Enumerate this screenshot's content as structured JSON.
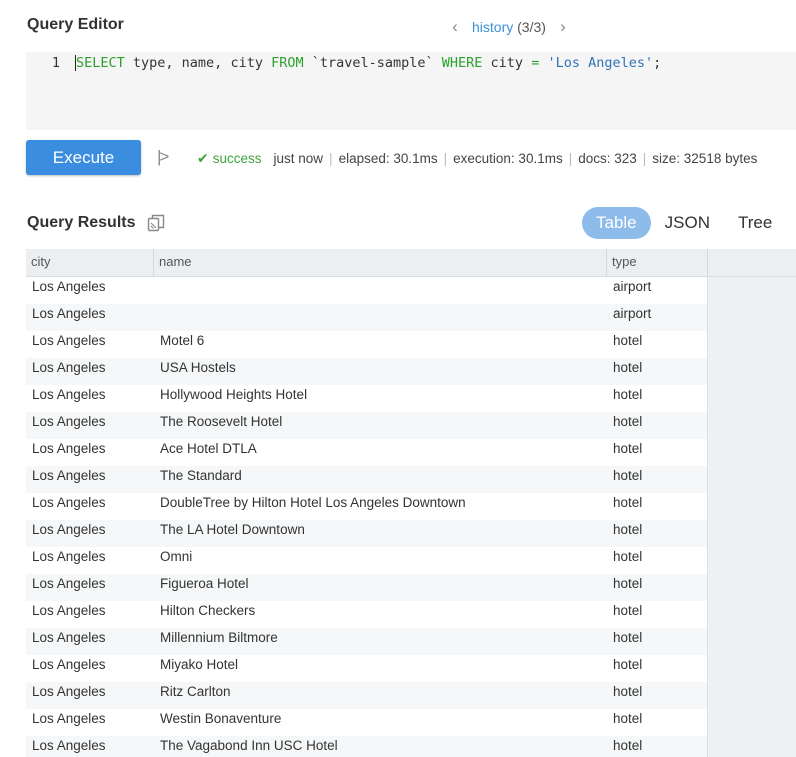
{
  "editor": {
    "title": "Query Editor",
    "history_link": "history",
    "history_count": "(3/3)",
    "line_number": "1",
    "query_tokens": [
      {
        "t": "SELECT",
        "k": "kw"
      },
      {
        "t": " type, name, city ",
        "k": "id"
      },
      {
        "t": "FROM",
        "k": "kw"
      },
      {
        "t": " `travel-sample` ",
        "k": "id"
      },
      {
        "t": "WHERE",
        "k": "kw"
      },
      {
        "t": " city ",
        "k": "id"
      },
      {
        "t": "=",
        "k": "kw"
      },
      {
        "t": " ",
        "k": "id"
      },
      {
        "t": "'Los Angeles'",
        "k": "str"
      },
      {
        "t": ";",
        "k": "id"
      }
    ]
  },
  "toolbar": {
    "execute_label": "Execute",
    "explain_label": "|>"
  },
  "status": {
    "result": "success",
    "when": "just now",
    "elapsed": "elapsed: 30.1ms",
    "execution": "execution: 30.1ms",
    "docs": "docs: 323",
    "size": "size: 32518 bytes"
  },
  "results": {
    "title": "Query Results",
    "tabs": [
      {
        "label": "Table",
        "active": true
      },
      {
        "label": "JSON",
        "active": false
      },
      {
        "label": "Tree",
        "active": false
      }
    ],
    "columns": [
      "city",
      "name",
      "type"
    ],
    "rows": [
      {
        "city": "Los Angeles",
        "name": "",
        "type": "airport"
      },
      {
        "city": "Los Angeles",
        "name": "",
        "type": "airport"
      },
      {
        "city": "Los Angeles",
        "name": "Motel 6",
        "type": "hotel"
      },
      {
        "city": "Los Angeles",
        "name": "USA Hostels",
        "type": "hotel"
      },
      {
        "city": "Los Angeles",
        "name": "Hollywood Heights Hotel",
        "type": "hotel"
      },
      {
        "city": "Los Angeles",
        "name": "The Roosevelt Hotel",
        "type": "hotel"
      },
      {
        "city": "Los Angeles",
        "name": "Ace Hotel DTLA",
        "type": "hotel"
      },
      {
        "city": "Los Angeles",
        "name": "The Standard",
        "type": "hotel"
      },
      {
        "city": "Los Angeles",
        "name": "DoubleTree by Hilton Hotel Los Angeles Downtown",
        "type": "hotel"
      },
      {
        "city": "Los Angeles",
        "name": "The LA Hotel Downtown",
        "type": "hotel"
      },
      {
        "city": "Los Angeles",
        "name": "Omni",
        "type": "hotel"
      },
      {
        "city": "Los Angeles",
        "name": "Figueroa Hotel",
        "type": "hotel"
      },
      {
        "city": "Los Angeles",
        "name": "Hilton Checkers",
        "type": "hotel"
      },
      {
        "city": "Los Angeles",
        "name": "Millennium Biltmore",
        "type": "hotel"
      },
      {
        "city": "Los Angeles",
        "name": "Miyako Hotel",
        "type": "hotel"
      },
      {
        "city": "Los Angeles",
        "name": "Ritz Carlton",
        "type": "hotel"
      },
      {
        "city": "Los Angeles",
        "name": "Westin Bonaventure",
        "type": "hotel"
      },
      {
        "city": "Los Angeles",
        "name": "The Vagabond Inn USC Hotel",
        "type": "hotel"
      }
    ]
  },
  "colors": {
    "accent": "#3b8de0",
    "active_tab": "#8dbbea",
    "success": "#3da33d",
    "keyword": "#2ca02c",
    "string": "#2f73b8"
  },
  "icons": {
    "prev": "chevron-left-icon",
    "next": "chevron-right-icon",
    "check": "check-icon",
    "copy": "copy-icon",
    "explain": "explain-icon"
  }
}
